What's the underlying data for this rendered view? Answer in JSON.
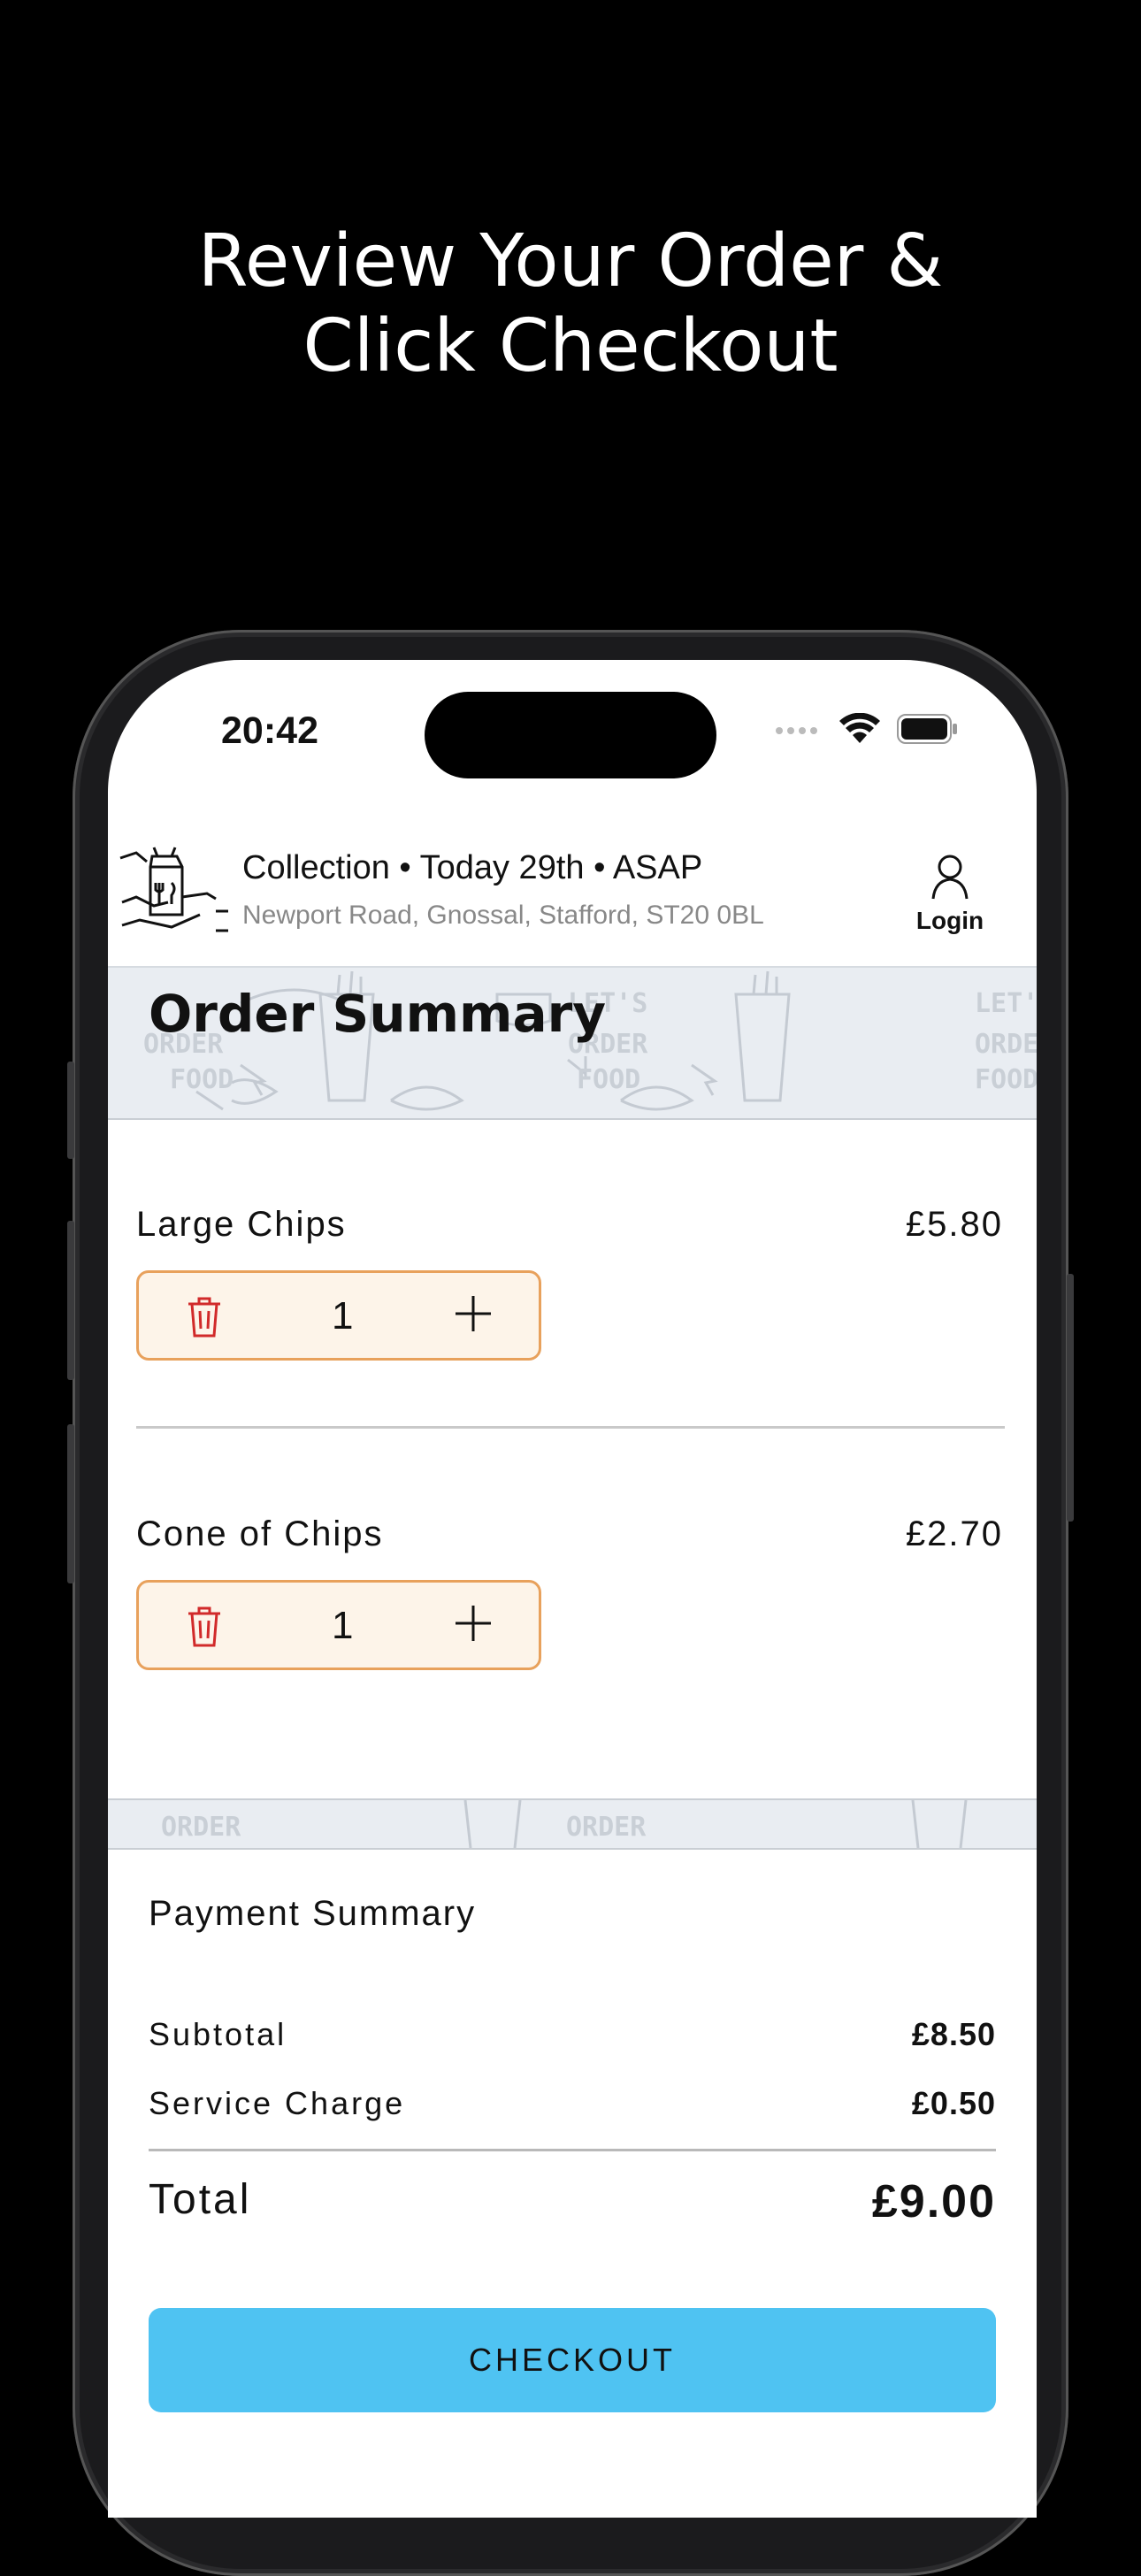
{
  "headline": {
    "line1": "Review Your Order &",
    "line2": "Click Checkout"
  },
  "status_bar": {
    "time": "20:42",
    "icons": [
      "cellular-icon",
      "wifi-icon",
      "battery-icon"
    ]
  },
  "header": {
    "order_info": "Collection • Today 29th • ASAP",
    "address": "Newport Road, Gnossal, Stafford, ST20  0BL",
    "login_label": "Login"
  },
  "banner": {
    "title": "Order Summary",
    "pattern_text": [
      "LET'S",
      "ORDER",
      "FOOD"
    ]
  },
  "items": [
    {
      "name": "Large Chips",
      "price": "£5.80",
      "quantity": "1"
    },
    {
      "name": "Cone of Chips",
      "price": "£2.70",
      "quantity": "1"
    }
  ],
  "strip": {
    "pattern_text": "ORDER"
  },
  "payment": {
    "title": "Payment Summary",
    "subtotal_label": "Subtotal",
    "subtotal_value": "£8.50",
    "service_label": "Service Charge",
    "service_value": "£0.50",
    "total_label": "Total",
    "total_value": "£9.00",
    "checkout_label": "CHECKOUT"
  },
  "colors": {
    "accent": "#4fc3f2",
    "qty_border": "#e8a15c",
    "qty_bg": "#fdf4e9",
    "trash": "#d12a2a"
  }
}
